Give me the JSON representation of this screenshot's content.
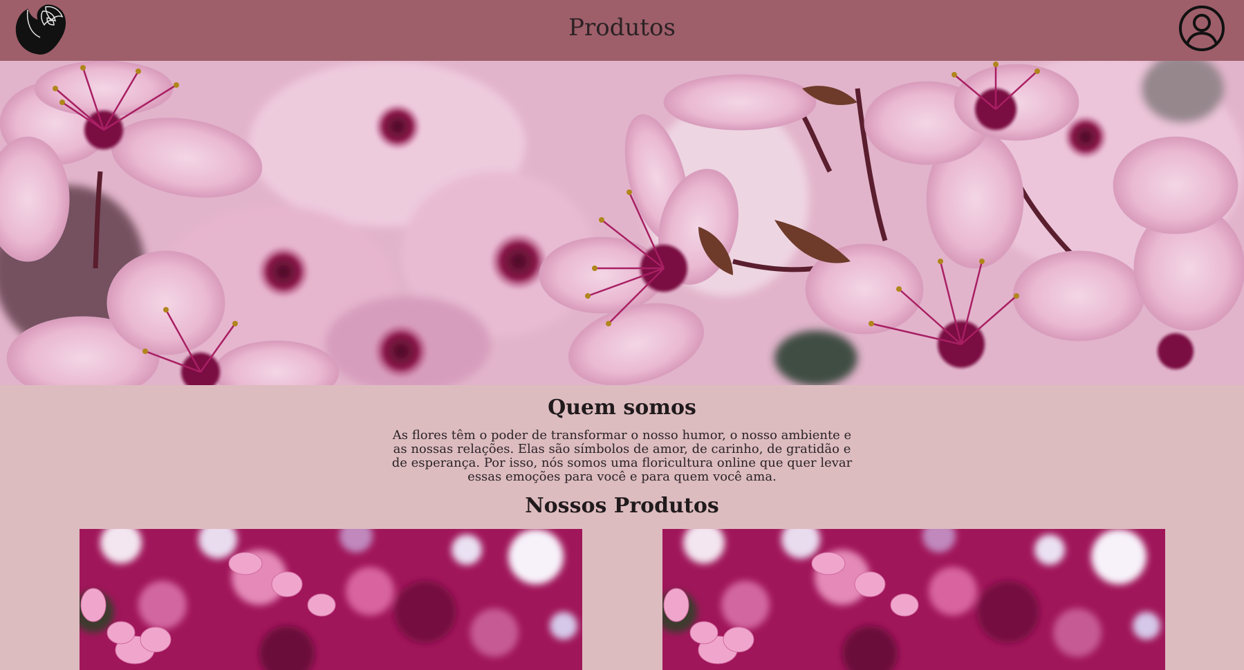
{
  "header": {
    "title": "Produtos",
    "logo_icon": "rose-logo-icon",
    "account_icon": "user-account-icon"
  },
  "hero": {
    "image": "pink-cherry-blossom-photo"
  },
  "about": {
    "title": "Quem somos",
    "text": "As flores têm o poder de transformar o nosso humor, o nosso ambiente e as nossas relações. Elas são símbolos de amor, de carinho, de gratidão e de esperança. Por isso, nós somos uma floricultura online que quer levar essas emoções para você e para quem você ama."
  },
  "products": {
    "title": "Nossos Produtos",
    "items": [
      {
        "image": "magenta-blossom-photo"
      },
      {
        "image": "magenta-blossom-photo"
      }
    ]
  },
  "colors": {
    "header_bg": "#9e5f6a",
    "page_bg": "#ddbcc0",
    "text": "#1f1a1c"
  }
}
